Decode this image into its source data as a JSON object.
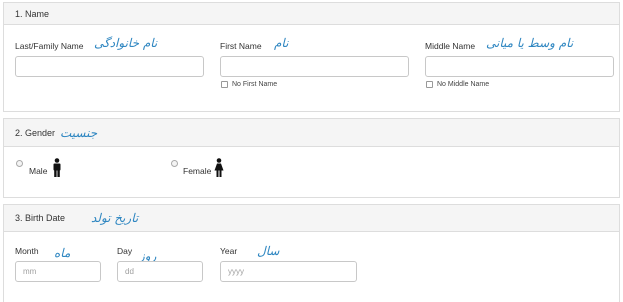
{
  "name_section": {
    "title": "1. Name",
    "last_label": "Last/Family Name",
    "last_persian": "نام خانوادگی",
    "first_label": "First Name",
    "first_persian": "نام",
    "middle_label": "Middle Name",
    "middle_persian": "نام وسط یا میانی",
    "no_first_label": "No First Name",
    "no_middle_label": "No Middle Name"
  },
  "gender_section": {
    "title": "2. Gender",
    "title_persian": "جنسیت",
    "male_label": "Male",
    "female_label": "Female",
    "male_icon": "male-person-icon",
    "female_icon": "female-person-icon"
  },
  "birth_section": {
    "title": "3. Birth Date",
    "title_persian": "تاریخ تولد",
    "month_label": "Month",
    "month_persian": "ماه",
    "month_placeholder": "mm",
    "day_label": "Day",
    "day_persian": "روز",
    "day_placeholder": "dd",
    "year_label": "Year",
    "year_persian": "سال",
    "year_placeholder": "yyyy"
  },
  "colors": {
    "persian_text": "#2e86c1",
    "header_bg": "#f5f5f5",
    "border": "#dddddd"
  }
}
